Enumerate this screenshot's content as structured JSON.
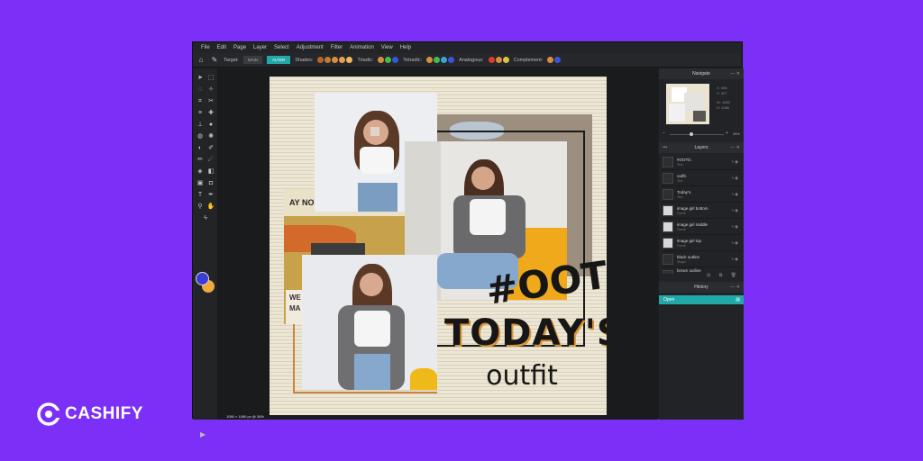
{
  "menu": [
    "File",
    "Edit",
    "Page",
    "Layer",
    "Select",
    "Adjustment",
    "Filter",
    "Animation",
    "View",
    "Help"
  ],
  "options": {
    "target_label": "Target:",
    "target_main": "MAIN",
    "target_alter": "ALTER",
    "shades_label": "Shades:",
    "triadic_label": "Triadic:",
    "tetradic_label": "Tetradic:",
    "analogous_label": "Analogous:",
    "complement_label": "Complement:",
    "shades": [
      "#b8652a",
      "#c87a33",
      "#d98e3f",
      "#e8a04c",
      "#f3b75d"
    ],
    "triadic": [
      "#d98e3f",
      "#3fbf4a",
      "#3b55d9"
    ],
    "tetradic": [
      "#d98e3f",
      "#3fbf4a",
      "#3fa0d9",
      "#3b55d9"
    ],
    "analogous": [
      "#d93f2a",
      "#d98e3f",
      "#d9c63f"
    ],
    "complement": [
      "#d98e3f",
      "#3b55d9"
    ]
  },
  "colors": {
    "background": "#7B2FF7",
    "accent": "#21a8a8",
    "foreground_color": "#3b3bd6",
    "background_color": "#f2a93b"
  },
  "canvas": {
    "sticker_ootd": "#OOTD",
    "sticker_today": "TODAY'S",
    "sticker_outfit": "outfit",
    "poster_text_1": "AY NOV",
    "poster_text_2": "WE",
    "poster_text_3": "MA"
  },
  "status": "1080 × 1080 px @ 36%",
  "navigate": {
    "title": "Navigate",
    "info": [
      "X:",
      "Y:",
      "W:",
      "H:"
    ],
    "info_values": [
      "456",
      "327",
      "1080",
      "1080"
    ],
    "zoom": "36%"
  },
  "layers": {
    "title": "Layers",
    "items": [
      {
        "name": "#OOTD.",
        "type": "Text"
      },
      {
        "name": "outfit.",
        "type": "Text"
      },
      {
        "name": "Today's.",
        "type": "Text"
      },
      {
        "name": "image girl bottom",
        "type": "Frame"
      },
      {
        "name": "image girl middle",
        "type": "Frame"
      },
      {
        "name": "image girl top",
        "type": "Frame"
      },
      {
        "name": "black outline",
        "type": "Shape"
      },
      {
        "name": "brown outline",
        "type": "Shape"
      }
    ]
  },
  "history": {
    "title": "History",
    "items": [
      "Open"
    ]
  },
  "brand": {
    "name": "CASHIFY"
  }
}
